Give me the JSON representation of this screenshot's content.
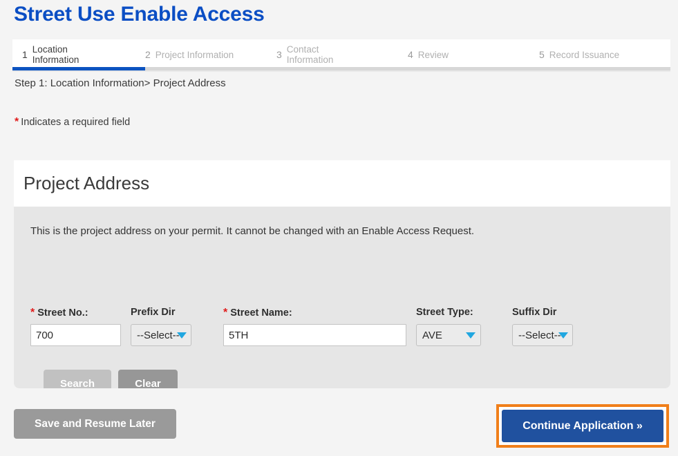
{
  "page": {
    "title": "Street Use Enable Access"
  },
  "steps": {
    "items": [
      {
        "num": "1",
        "label": "Location Information",
        "active": true
      },
      {
        "num": "2",
        "label": "Project Information",
        "active": false
      },
      {
        "num": "3",
        "label": "Contact Information",
        "active": false
      },
      {
        "num": "4",
        "label": "Review",
        "active": false
      },
      {
        "num": "5",
        "label": "Record Issuance",
        "active": false
      }
    ]
  },
  "breadcrumb": {
    "step": "Step 1",
    "separator1": ":",
    "section": "Location Information",
    "separator2": ">",
    "page": "Project Address"
  },
  "required_note": {
    "star": "*",
    "text": "Indicates a required field"
  },
  "panel": {
    "heading": "Project Address",
    "description": "This is the project address on your permit. It cannot be changed with an Enable Access Request."
  },
  "form": {
    "street_no": {
      "label": "Street No.:",
      "required": true,
      "star": "*",
      "value": "700",
      "placeholder": ""
    },
    "prefix_dir": {
      "label": "Prefix Dir",
      "required": false,
      "value": "--Select--"
    },
    "street_name": {
      "label": "Street Name:",
      "required": true,
      "star": "*",
      "value": "5TH",
      "placeholder": ""
    },
    "street_type": {
      "label": "Street Type:",
      "required": false,
      "value": "AVE"
    },
    "suffix_dir": {
      "label": "Suffix Dir",
      "required": false,
      "value": "--Select--"
    },
    "search_button": "Search",
    "clear_button": "Clear"
  },
  "footer": {
    "save_button": "Save and Resume Later",
    "continue_button": "Continue Application »"
  },
  "colors": {
    "title_blue": "#0b4ec4",
    "step_active_blue": "#0c53c0",
    "required_red": "#e01b1b",
    "caret_blue": "#21a7e0",
    "continue_blue": "#20519f",
    "highlight_orange": "#f07f1a",
    "page_background": "#f4f4f4",
    "panel_body": "#e6e6e6"
  }
}
